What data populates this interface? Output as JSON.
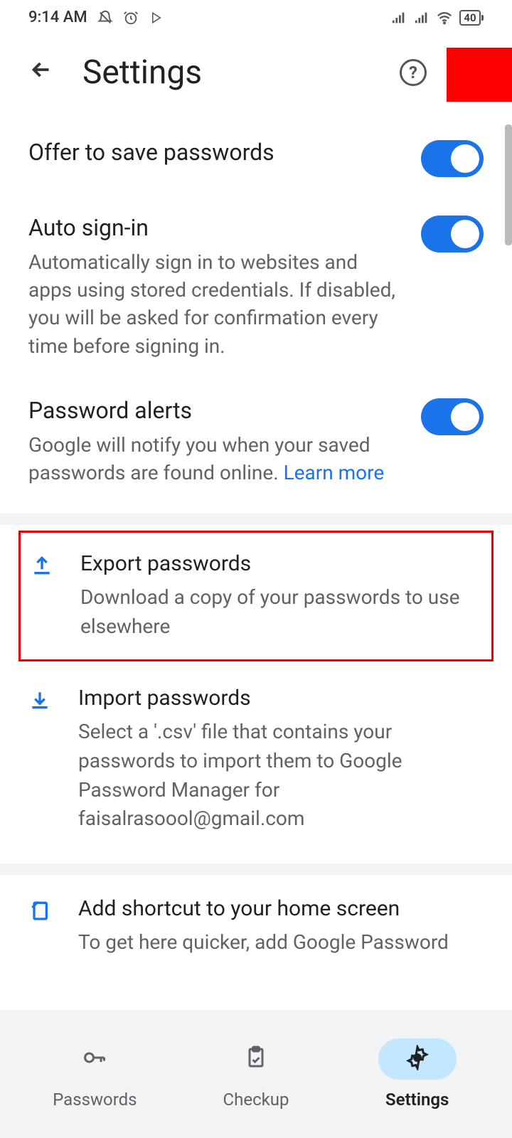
{
  "statusBar": {
    "time": "9:14 AM",
    "battery": "40"
  },
  "header": {
    "title": "Settings"
  },
  "settings": [
    {
      "title": "Offer to save passwords",
      "desc": "",
      "toggle": true
    },
    {
      "title": "Auto sign-in",
      "desc": "Automatically sign in to websites and apps using stored credentials. If disabled, you will be asked for confirmation every time before signing in.",
      "toggle": true
    },
    {
      "title": "Password alerts",
      "desc": "Google will notify you when your saved passwords are found online. ",
      "link": "Learn more",
      "toggle": true
    }
  ],
  "actions": {
    "export": {
      "title": "Export passwords",
      "desc": "Download a copy of your passwords to use elsewhere"
    },
    "import": {
      "title": "Import passwords",
      "desc": "Select a '.csv' file that contains your passwords to import them to Google Password Manager for faisalrasoool@gmail.com"
    }
  },
  "shortcut": {
    "title": "Add shortcut to your home screen",
    "desc": "To get here quicker, add Google Password"
  },
  "nav": {
    "passwords": "Passwords",
    "checkup": "Checkup",
    "settings": "Settings"
  }
}
